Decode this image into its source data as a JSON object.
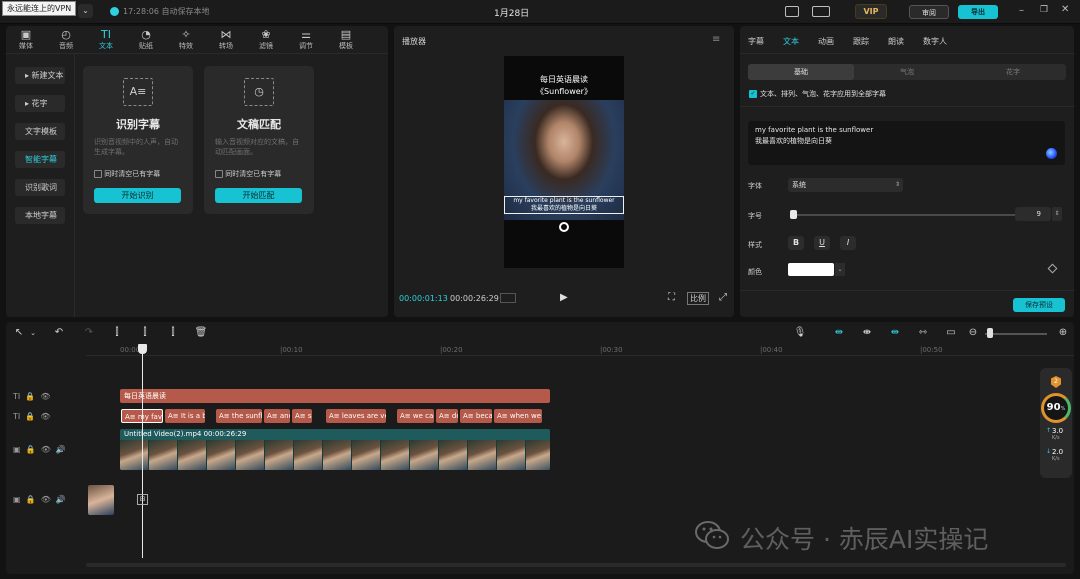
{
  "top": {
    "tooltip": "永远能连上的VPN",
    "autosave": "17:28:06 自动保存本地",
    "project_title": "1月28日",
    "vip": "VIP",
    "review_label": "审阅",
    "export_label": "导出"
  },
  "left": {
    "tabs": [
      {
        "label": "媒体",
        "icon": "▣"
      },
      {
        "label": "音频",
        "icon": "◴"
      },
      {
        "label": "文本",
        "icon": "TI"
      },
      {
        "label": "贴纸",
        "icon": "◔"
      },
      {
        "label": "特效",
        "icon": "✧"
      },
      {
        "label": "转场",
        "icon": "⋈"
      },
      {
        "label": "滤镜",
        "icon": "❀"
      },
      {
        "label": "调节",
        "icon": "⚌"
      },
      {
        "label": "模板",
        "icon": "▤"
      }
    ],
    "side": [
      "▸ 新建文本",
      "▸ 花字",
      "文字模板",
      "智能字幕",
      "识别歌词",
      "本地字幕"
    ],
    "card1": {
      "title": "识别字幕",
      "desc": "识别音视频中的人声，自动生成字幕。",
      "check": "同时清空已有字幕",
      "button": "开始识别"
    },
    "card2": {
      "title": "文稿匹配",
      "desc": "输入音视频对应的文稿，自动匹配画面。",
      "check": "同时清空已有字幕",
      "button": "开始匹配"
    }
  },
  "player": {
    "title": "播放器",
    "video_title_line1": "每日英语晨读",
    "video_title_line2": "《Sunflower》",
    "subtitle_en": "my favorite plant is the sunflower",
    "subtitle_cn": "我最喜欢的植物是向日葵",
    "time_current": "00:00:01:13",
    "time_total": "00:00:26:29",
    "ratio": "比例"
  },
  "right": {
    "tabs": [
      "字幕",
      "文本",
      "动画",
      "跟踪",
      "朗读",
      "数字人"
    ],
    "active_tab": 1,
    "seg": [
      "基础",
      "气泡",
      "花字"
    ],
    "apply_all": "文本、排列、气泡、花字应用到全部字幕",
    "text_en": "my favorite plant is the sunflower",
    "text_cn": "我最喜欢的植物是向日葵",
    "font_label": "字体",
    "font_value": "系统",
    "size_label": "字号",
    "size_value": "9",
    "size_fraction": 0.01,
    "style_label": "样式",
    "color_label": "颜色",
    "color_value": "#ffffff",
    "save_preset": "保存预设"
  },
  "timeline": {
    "ruler": [
      "00:00",
      "|00:10",
      "|00:20",
      "|00:30",
      "|00:40",
      "|00:50"
    ],
    "title_clip": "每日英语晨读",
    "subtitle_clips": [
      "my favo",
      "It is a b",
      "the sunfl",
      "and",
      "sr",
      "leaves are ve",
      "we can",
      "do",
      "becau",
      "when we"
    ],
    "video_clip": "Untitled Video(2).mp4  00:00:26:29",
    "zoom_fraction": 0.05,
    "score": "90",
    "score_unit": "%",
    "badge": "2",
    "upload": "3.0",
    "download": "2.0",
    "rate_unit": "K/s"
  },
  "watermark": "公众号 · 赤辰AI实操记"
}
